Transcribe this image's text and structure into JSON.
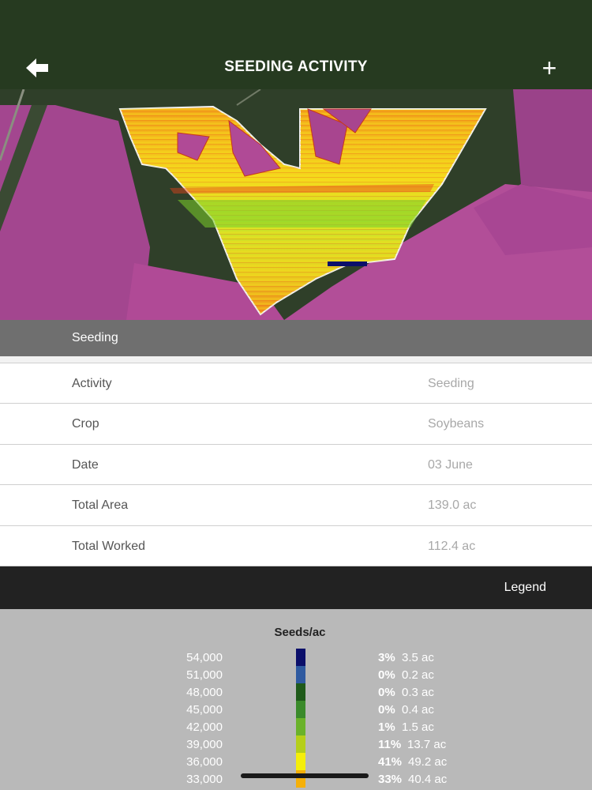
{
  "header": {
    "title": "SEEDING ACTIVITY",
    "back_icon": "arrow-left-icon",
    "add_icon": "plus-icon"
  },
  "map": {
    "description_icon": "field-map"
  },
  "section": {
    "title": "Seeding"
  },
  "details": [
    {
      "label": "Activity",
      "value": "Seeding"
    },
    {
      "label": "Crop",
      "value": "Soybeans"
    },
    {
      "label": "Date",
      "value": "03 June"
    },
    {
      "label": "Total Area",
      "value": "139.0 ac"
    },
    {
      "label": "Total Worked",
      "value": "112.4 ac"
    }
  ],
  "legend_bar": {
    "label": "Legend"
  },
  "legend": {
    "title": "Seeds/ac",
    "rows": [
      {
        "seeds": "54,000",
        "pct": "3%",
        "area": "3.5 ac",
        "color": "#0b0f6a"
      },
      {
        "seeds": "51,000",
        "pct": "0%",
        "area": "0.2 ac",
        "color": "#2f5aa0"
      },
      {
        "seeds": "48,000",
        "pct": "0%",
        "area": "0.3 ac",
        "color": "#1f5a1a"
      },
      {
        "seeds": "45,000",
        "pct": "0%",
        "area": "0.4 ac",
        "color": "#3a8a2a"
      },
      {
        "seeds": "42,000",
        "pct": "1%",
        "area": "1.5 ac",
        "color": "#6ab22a"
      },
      {
        "seeds": "39,000",
        "pct": "11%",
        "area": "13.7 ac",
        "color": "#b5cf1a"
      },
      {
        "seeds": "36,000",
        "pct": "41%",
        "area": "49.2 ac",
        "color": "#f5ee0a"
      },
      {
        "seeds": "33,000",
        "pct": "33%",
        "area": "40.4 ac",
        "color": "#f5b00a"
      }
    ]
  },
  "colors": {
    "topbar": "#263a20",
    "section_header": "#6f6f6f",
    "legend_bar": "#222222",
    "legend_bg": "#b9b9b9"
  }
}
